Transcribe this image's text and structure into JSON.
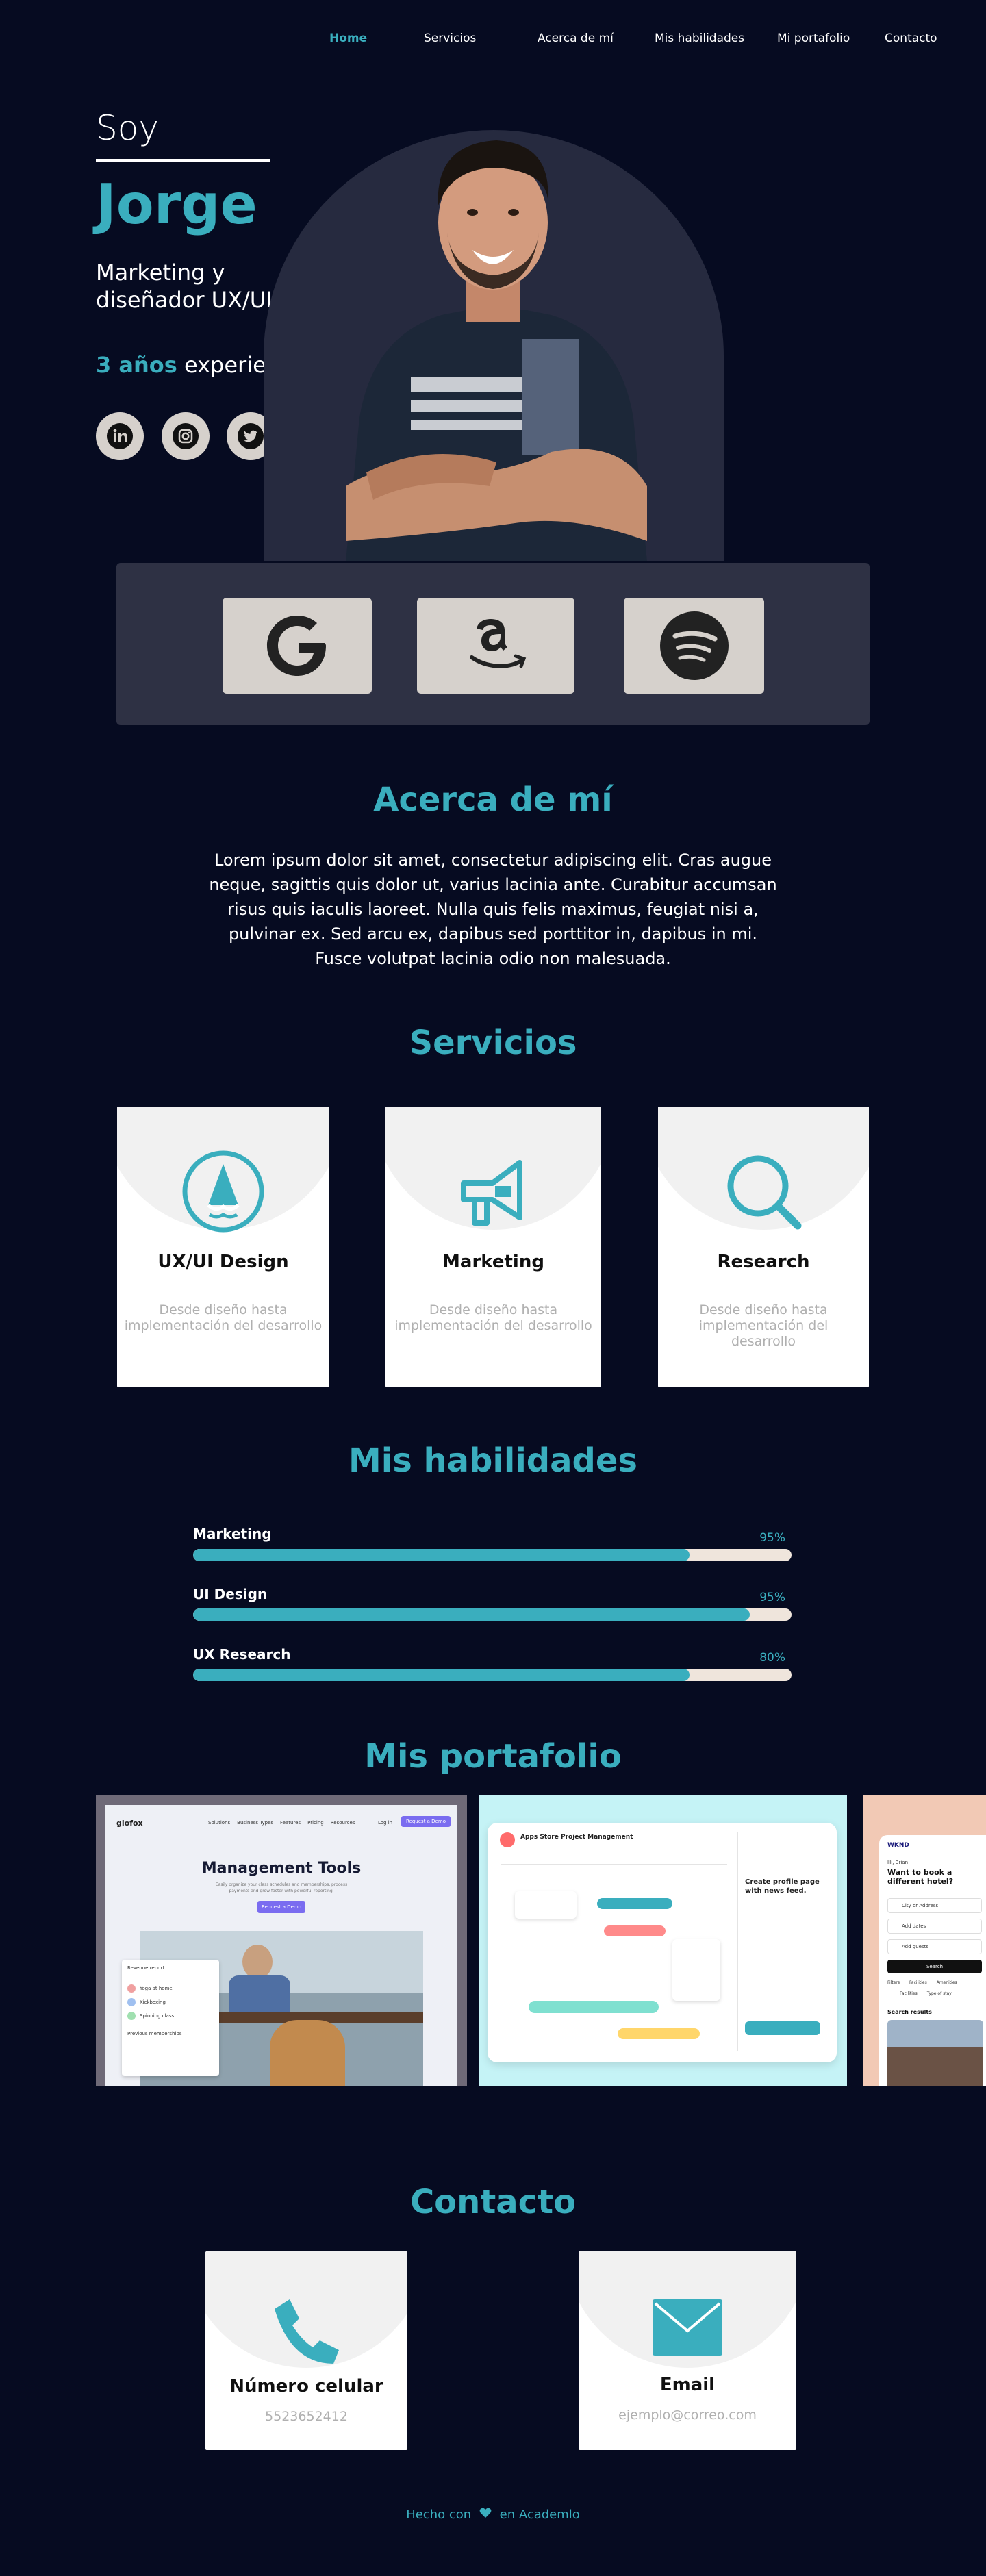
{
  "nav": {
    "items": [
      "Home",
      "Servicios",
      "Acerca de mí",
      "Mis habilidades",
      "Mi portafolio",
      "Contacto"
    ],
    "active": "Home"
  },
  "hero": {
    "greeting": "Soy",
    "name": "Jorge",
    "role": "Marketing y diseñador UX/UI",
    "experience_highlight": "3 años",
    "experience_rest": "experiencia",
    "socials": [
      "linkedin-icon",
      "instagram-icon",
      "twitter-icon"
    ]
  },
  "brands": [
    "google-logo",
    "amazon-logo",
    "spotify-logo"
  ],
  "about": {
    "title": "Acerca de mí",
    "text": "Lorem ipsum dolor sit amet, consectetur adipiscing elit. Cras augue neque, sagittis quis dolor ut, varius lacinia ante. Curabitur accumsan risus quis iaculis laoreet. Nulla quis felis maximus, feugiat nisi a, pulvinar ex. Sed arcu ex, dapibus sed porttitor in, dapibus in mi. Fusce volutpat lacinia odio non malesuada."
  },
  "services": {
    "title": "Servicios",
    "items": [
      {
        "title": "UX/UI Design",
        "desc": "Desde diseño hasta implementación del desarrollo",
        "icon": "pen-tool-icon"
      },
      {
        "title": "Marketing",
        "desc": "Desde diseño hasta implementación del desarrollo",
        "icon": "megaphone-icon"
      },
      {
        "title": "Research",
        "desc": "Desde diseño hasta implementación del desarrollo",
        "icon": "search-icon"
      }
    ]
  },
  "skills": {
    "title": "Mis habilidades",
    "items": [
      {
        "label": "Marketing",
        "pct_text": "95%",
        "fill": 0.83
      },
      {
        "label": "UI Design",
        "pct_text": "95%",
        "fill": 0.93
      },
      {
        "label": "UX Research",
        "pct_text": "80%",
        "fill": 0.83
      }
    ]
  },
  "portfolio": {
    "title": "Mis portafolio",
    "shot1": {
      "logo": "glofox",
      "nav": [
        "Solutions",
        "Business Types",
        "Features",
        "Pricing",
        "Resources"
      ],
      "login": "Log in",
      "cta": "Request a Demo",
      "headline": "Management Tools",
      "sub": "Easily organize your class schedules and memberships, process payments and grow faster with powerful reporting.",
      "button": "Request a Demo",
      "panel_title": "Revenue report",
      "panel_rows": [
        "Yoga at home",
        "Kickboxing",
        "Spinning class"
      ],
      "panel_footer": "Previous memberships"
    },
    "shot2": {
      "title": "Apps Store Project Management",
      "right_title": "Create profile page with news feed."
    },
    "shot3": {
      "logo": "WKND",
      "greeting": "Hi, Brian",
      "question": "Want to book a different hotel?",
      "fields": [
        "City or Address",
        "Add dates",
        "Add guests"
      ],
      "search": "Search",
      "filters": [
        "Filters",
        "Facilities",
        "Amenities"
      ],
      "tabs": [
        "Facilities",
        "Type of stay"
      ],
      "results": "Search results"
    }
  },
  "contact": {
    "title": "Contacto",
    "phone_title": "Número celular",
    "phone": "5523652412",
    "email_title": "Email",
    "email": "ejemplo@correo.com"
  },
  "footer": {
    "prefix": "Hecho con",
    "suffix": "en Academlo"
  },
  "colors": {
    "background": "#060b21",
    "accent": "#3aaebe",
    "card": "#ffffff",
    "brand_tile": "#d6d1cc"
  }
}
